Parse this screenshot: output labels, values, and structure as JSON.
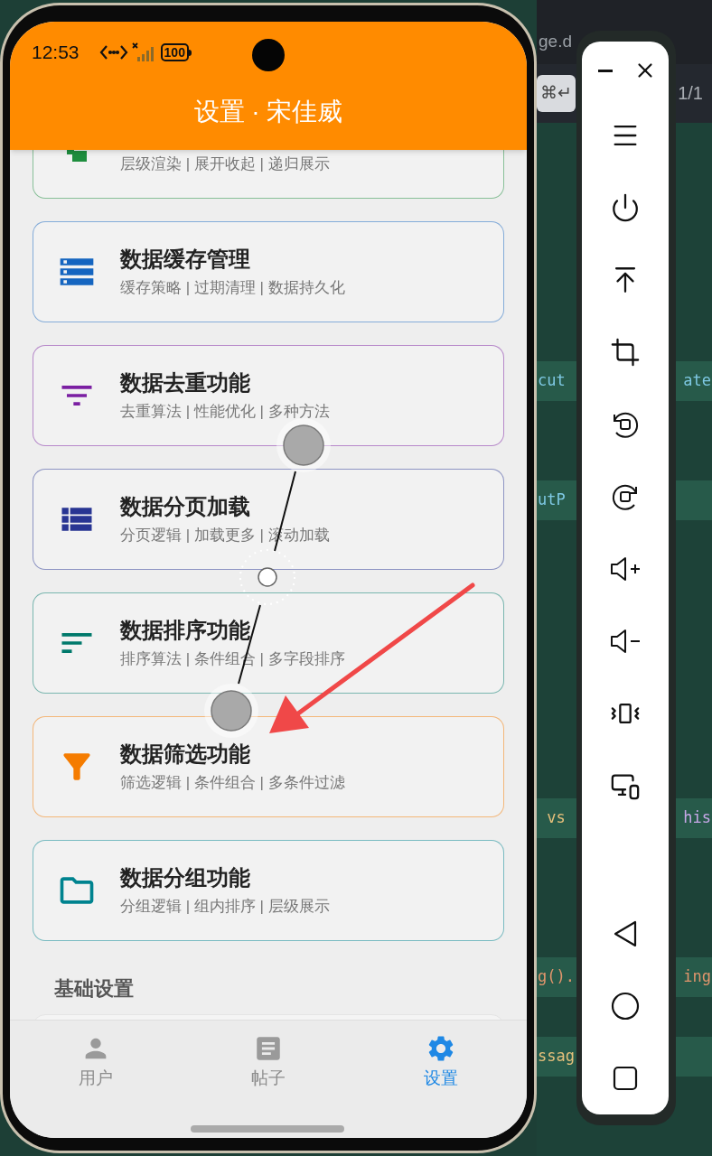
{
  "phone": {
    "status_bar": {
      "time": "12:53",
      "battery": "100"
    },
    "header": {
      "title": "设置 · 宋佳威"
    },
    "feature_cards": [
      {
        "kind": "tree",
        "color": "#1e8e3e",
        "subtitle": "层级渲染 | 展开收起 | 递归展示"
      },
      {
        "kind": "storage",
        "color": "#1565c0",
        "title": "数据缓存管理",
        "subtitle": "缓存策略 | 过期清理 | 数据持久化"
      },
      {
        "kind": "filter-lines",
        "color": "#7b1fa2",
        "title": "数据去重功能",
        "subtitle": "去重算法 | 性能优化 | 多种方法"
      },
      {
        "kind": "list",
        "color": "#283593",
        "title": "数据分页加载",
        "subtitle": "分页逻辑 | 加载更多 | 滚动加载"
      },
      {
        "kind": "sort",
        "color": "#00796b",
        "title": "数据排序功能",
        "subtitle": "排序算法 | 条件组合 | 多字段排序"
      },
      {
        "kind": "funnel",
        "color": "#f57c00",
        "title": "数据筛选功能",
        "subtitle": "筛选逻辑 | 条件组合 | 多条件过滤"
      },
      {
        "kind": "folder",
        "color": "#00838f",
        "title": "数据分组功能",
        "subtitle": "分组逻辑 | 组内排序 | 层级展示"
      }
    ],
    "section_title": "基础设置",
    "bottom_nav": [
      {
        "kind": "person",
        "label": "用户",
        "selected": false
      },
      {
        "kind": "article",
        "label": "帖子",
        "selected": false
      },
      {
        "kind": "gear",
        "label": "设置",
        "selected": true
      }
    ]
  },
  "editor": {
    "tab_fragment": "ge.d",
    "shortcut": "⌘↵",
    "match_count": "1/1",
    "code_lines": [
      {
        "left": {
          "text": "cut",
          "kind": "property"
        },
        "right": {
          "text": "ate",
          "kind": "property"
        }
      },
      {
        "left": {
          "text": "utP",
          "kind": "property"
        }
      },
      {
        "left": {
          "text": " vs",
          "kind": "keyword"
        },
        "right": {
          "text": "his",
          "kind": "variable"
        }
      },
      {
        "left": {
          "text": "g().",
          "kind": "string"
        },
        "right": {
          "text": "ing",
          "kind": "string"
        }
      },
      {
        "left": {
          "text": "ssag",
          "kind": "keyword"
        }
      }
    ]
  }
}
